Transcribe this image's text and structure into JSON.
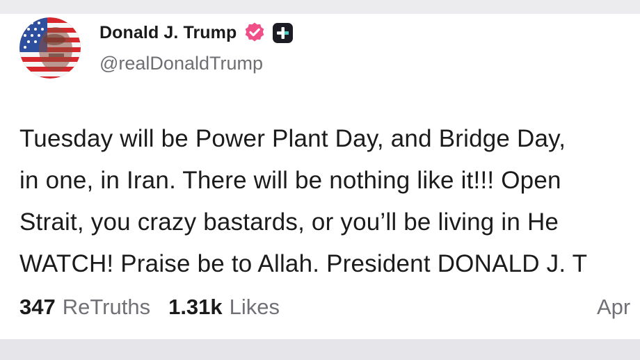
{
  "post": {
    "author": {
      "display_name": "Donald J. Trump",
      "handle": "@realDonaldTrump",
      "avatar_icon": "flag-portrait-avatar",
      "verified_icon": "verified-badge-icon",
      "extra_badge_icon": "plus-badge-icon"
    },
    "body_lines": [
      "Tuesday will be Power Plant Day, and Bridge Day,",
      "in one, in Iran. There will be nothing like it!!! Open",
      "Strait, you crazy bastards, or you’ll be living in He",
      "WATCH! Praise be to Allah. President DONALD J. T"
    ],
    "stats": {
      "retruths_count": "347",
      "retruths_label": "ReTruths",
      "likes_count": "1.31k",
      "likes_label": "Likes"
    },
    "timestamp": "Apr"
  },
  "colors": {
    "verified_badge": "#f04f88",
    "plus_badge": "#1c1c24",
    "text_primary": "#1b1b1b",
    "text_secondary": "#6e6e73"
  }
}
